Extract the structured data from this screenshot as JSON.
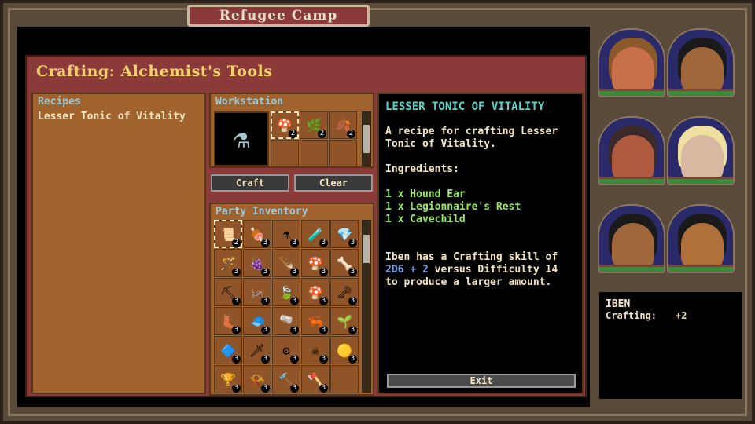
{
  "location_title": "Refugee Camp",
  "crafting": {
    "title": "Crafting: Alchemist's Tools",
    "recipes_label": "Recipes",
    "recipes": [
      "Lesser Tonic of Vitality"
    ],
    "workstation_label": "Workstation",
    "workstation_slots": [
      {
        "icon": "ear-icon",
        "glyph": "🍄",
        "count": "2",
        "selected": true
      },
      {
        "icon": "herb-icon",
        "glyph": "🌿",
        "count": "2",
        "selected": false
      },
      {
        "icon": "leaf-icon",
        "glyph": "🍂",
        "count": "2",
        "selected": false
      },
      {
        "icon": "",
        "glyph": "",
        "count": "",
        "selected": false
      },
      {
        "icon": "",
        "glyph": "",
        "count": "",
        "selected": false
      },
      {
        "icon": "",
        "glyph": "",
        "count": "",
        "selected": false
      }
    ],
    "craft_label": "Craft",
    "clear_label": "Clear",
    "inventory_label": "Party Inventory",
    "inventory": [
      {
        "icon": "scroll-icon",
        "glyph": "📜",
        "count": "2",
        "selected": true
      },
      {
        "icon": "meat-icon",
        "glyph": "🍖",
        "count": "3"
      },
      {
        "icon": "potion-icon",
        "glyph": "⚗",
        "count": "3"
      },
      {
        "icon": "potion-red-icon",
        "glyph": "🧪",
        "count": "3"
      },
      {
        "icon": "gem-icon",
        "glyph": "💎",
        "count": "3"
      },
      {
        "icon": "wand-icon",
        "glyph": "🪄",
        "count": "3"
      },
      {
        "icon": "berries-icon",
        "glyph": "🍇",
        "count": "3"
      },
      {
        "icon": "feather-icon",
        "glyph": "🪶",
        "count": "3"
      },
      {
        "icon": "mushroom-icon",
        "glyph": "🍄",
        "count": "3"
      },
      {
        "icon": "bone-icon",
        "glyph": "🦴",
        "count": "3"
      },
      {
        "icon": "pickaxe-icon",
        "glyph": "⛏",
        "count": "3"
      },
      {
        "icon": "insect-icon",
        "glyph": "🦗",
        "count": "3"
      },
      {
        "icon": "leaf-icon",
        "glyph": "🍃",
        "count": "3"
      },
      {
        "icon": "mushroom-red-icon",
        "glyph": "🍄",
        "count": "3"
      },
      {
        "icon": "key-icon",
        "glyph": "🗝",
        "count": "3"
      },
      {
        "icon": "boot-icon",
        "glyph": "👢",
        "count": "3"
      },
      {
        "icon": "cap-icon",
        "glyph": "🧢",
        "count": "3"
      },
      {
        "icon": "flask-icon",
        "glyph": "🫗",
        "count": "3"
      },
      {
        "icon": "shrimp-icon",
        "glyph": "🦐",
        "count": "3"
      },
      {
        "icon": "leaf-green-icon",
        "glyph": "🌱",
        "count": "3"
      },
      {
        "icon": "crystal-icon",
        "glyph": "🔷",
        "count": "3"
      },
      {
        "icon": "dagger-icon",
        "glyph": "🗡",
        "count": "3"
      },
      {
        "icon": "gear-icon",
        "glyph": "⚙",
        "count": "3"
      },
      {
        "icon": "crossbones-icon",
        "glyph": "☠",
        "count": "3"
      },
      {
        "icon": "orb-icon",
        "glyph": "🟡",
        "count": "3"
      },
      {
        "icon": "cup-icon",
        "glyph": "🏆",
        "count": "3"
      },
      {
        "icon": "horn-icon",
        "glyph": "📯",
        "count": "3"
      },
      {
        "icon": "hammer-icon",
        "glyph": "🔨",
        "count": "3"
      },
      {
        "icon": "axe-icon",
        "glyph": "🪓",
        "count": "3"
      },
      {
        "icon": "",
        "glyph": "",
        "count": ""
      }
    ],
    "description": {
      "title": "LESSER TONIC OF VITALITY",
      "intro": "A recipe for crafting Lesser Tonic of Vitality.",
      "ingredients_label": "Ingredients:",
      "ingredients": [
        "1 x Hound Ear",
        "1 x Legionnaire's Rest",
        "1 x Cavechild"
      ],
      "skill_pre": "Iben has a Crafting skill of ",
      "skill_value": "2D6 + 2",
      "skill_mid": " versus Difficulty ",
      "skill_difficulty": "14",
      "skill_post": " to produce a larger amount."
    },
    "exit_label": "Exit"
  },
  "party": [
    {
      "face": "#c8704a",
      "hair": "#8a5a2a"
    },
    {
      "face": "#a0683a",
      "hair": "#1a1a1a"
    },
    {
      "face": "#b05a40",
      "hair": "#3a2a2a"
    },
    {
      "face": "#d8b8a0",
      "hair": "#f0e0a0"
    },
    {
      "face": "#a0683a",
      "hair": "#1a1a1a"
    },
    {
      "face": "#b0703a",
      "hair": "#1a1a1a"
    }
  ],
  "character": {
    "name": "IBEN",
    "stat_label": "Crafting:",
    "stat_value": "+2"
  }
}
